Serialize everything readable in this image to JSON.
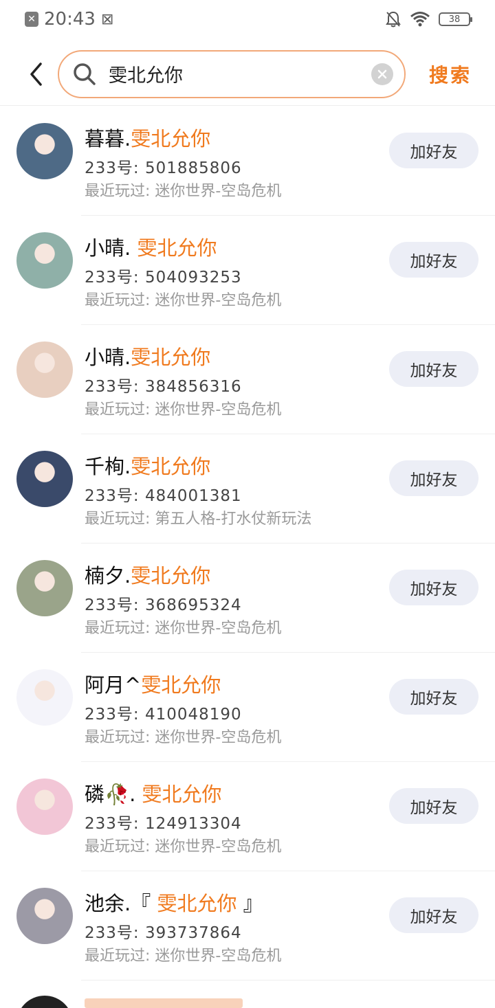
{
  "status_bar": {
    "time": "20:43",
    "battery": "38"
  },
  "search": {
    "query": "雯北允你",
    "button_label": "搜索"
  },
  "results": [
    {
      "name_prefix": "暮暮.",
      "name_highlight": "雯北允你",
      "name_suffix": "",
      "id_label": "233号:",
      "id_value": "501885806",
      "played_label": "最近玩过:",
      "played_game": "迷你世界-空岛危机",
      "add_label": "加好友",
      "avatar_color": "#4e6a86"
    },
    {
      "name_prefix": "小晴. ",
      "name_highlight": "雯北允你",
      "name_suffix": "",
      "id_label": "233号:",
      "id_value": "504093253",
      "played_label": "最近玩过:",
      "played_game": "迷你世界-空岛危机",
      "add_label": "加好友",
      "avatar_color": "#8fb0a8"
    },
    {
      "name_prefix": "小晴.",
      "name_highlight": "雯北允你",
      "name_suffix": "",
      "id_label": "233号:",
      "id_value": "384856316",
      "played_label": "最近玩过:",
      "played_game": "迷你世界-空岛危机",
      "add_label": "加好友",
      "avatar_color": "#e8cfc0"
    },
    {
      "name_prefix": "千栒.",
      "name_highlight": "雯北允你",
      "name_suffix": "",
      "id_label": "233号:",
      "id_value": "484001381",
      "played_label": "最近玩过:",
      "played_game": "第五人格-打水仗新玩法",
      "add_label": "加好友",
      "avatar_color": "#3a4a6a"
    },
    {
      "name_prefix": "楠夕.",
      "name_highlight": "雯北允你",
      "name_suffix": "",
      "id_label": "233号:",
      "id_value": "368695324",
      "played_label": "最近玩过:",
      "played_game": "迷你世界-空岛危机",
      "add_label": "加好友",
      "avatar_color": "#9aa48a"
    },
    {
      "name_prefix": "阿月^",
      "name_highlight": "雯北允你",
      "name_suffix": "",
      "id_label": "233号:",
      "id_value": "410048190",
      "played_label": "最近玩过:",
      "played_game": "迷你世界-空岛危机",
      "add_label": "加好友",
      "avatar_color": "#f4f4fa"
    },
    {
      "name_prefix": "磷🥀. ",
      "name_highlight": "雯北允你",
      "name_suffix": "",
      "id_label": "233号:",
      "id_value": "124913304",
      "played_label": "最近玩过:",
      "played_game": "迷你世界-空岛危机",
      "add_label": "加好友",
      "avatar_color": "#f2c6d6"
    },
    {
      "name_prefix": "池余.『 ",
      "name_highlight": "雯北允你",
      "name_suffix": " 』",
      "id_label": "233号:",
      "id_value": "393737864",
      "played_label": "最近玩过:",
      "played_game": "迷你世界-空岛危机",
      "add_label": "加好友",
      "avatar_color": "#9c9aa6"
    }
  ]
}
